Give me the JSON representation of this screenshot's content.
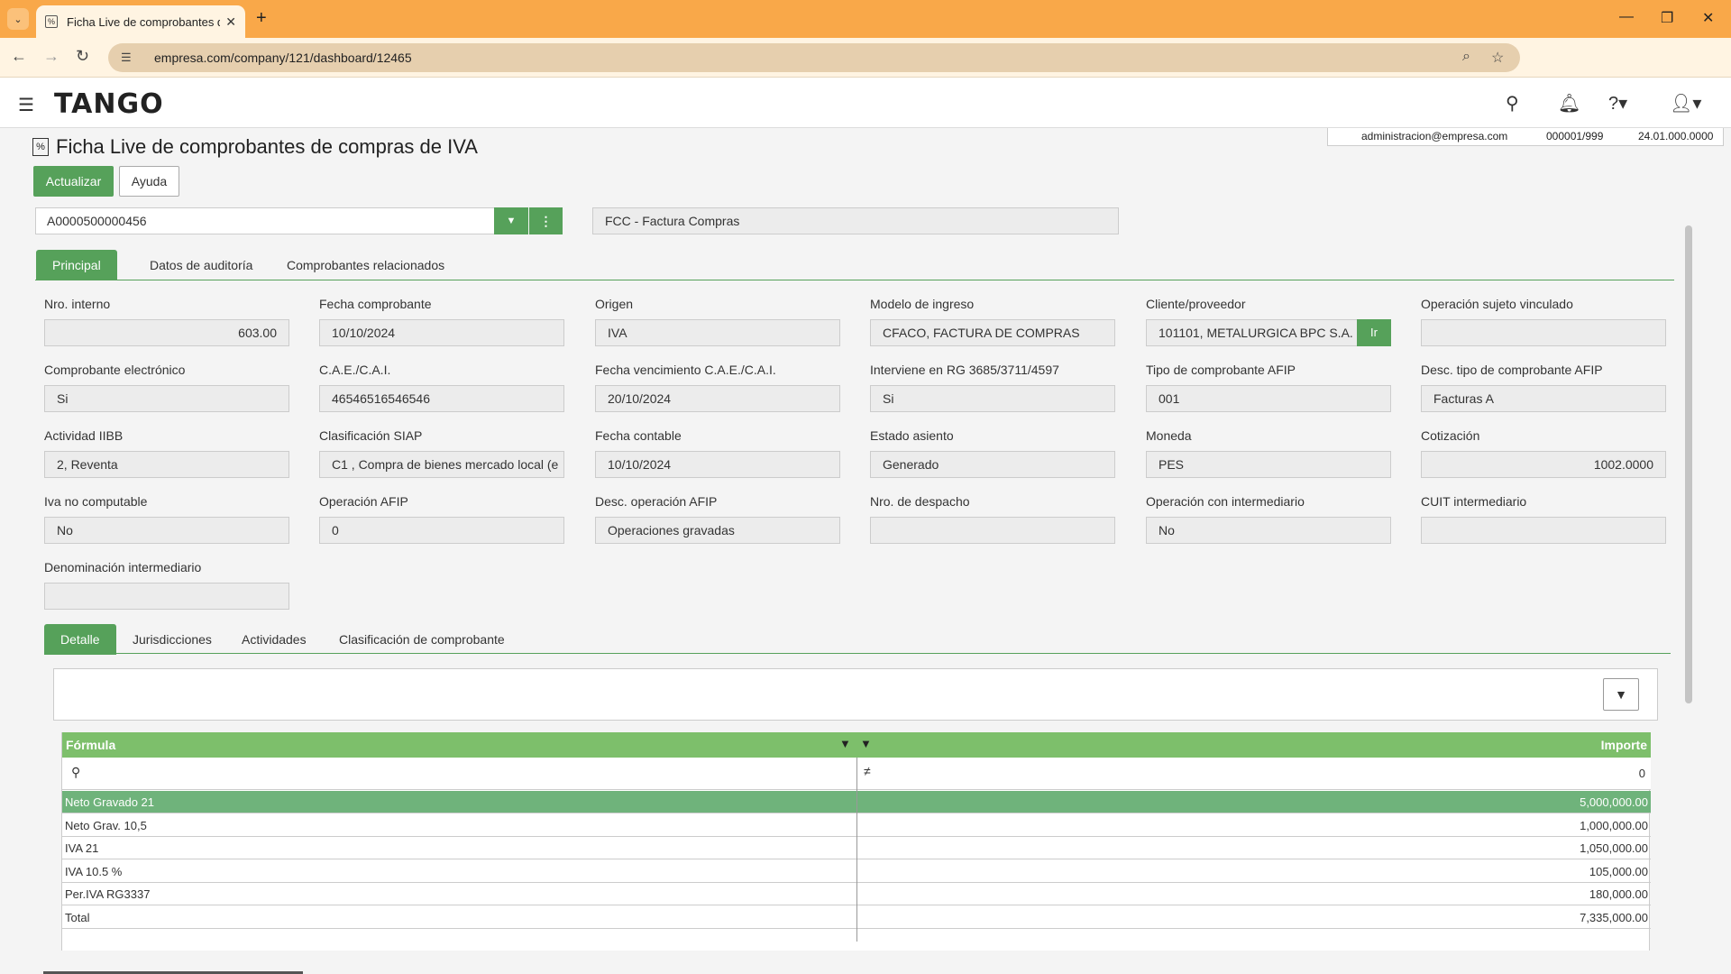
{
  "browser": {
    "tab_title": "Ficha Live de comprobantes de compras de IVA",
    "url": "empresa.com/company/121/dashboard/12465"
  },
  "header": {
    "logo": "TANGO"
  },
  "info": {
    "email": "administracion@empresa.com",
    "company": "000001/999",
    "version": "24.01.000.0000"
  },
  "page": {
    "title": "Ficha Live de comprobantes de compras de IVA",
    "btn_update": "Actualizar",
    "btn_help": "Ayuda",
    "selector_value": "A0000500000456",
    "selector_desc": "FCC - Factura Compras"
  },
  "tabs": [
    "Principal",
    "Datos de auditoría",
    "Comprobantes relacionados"
  ],
  "fields": [
    {
      "label": "Nro. interno",
      "value": "603.00",
      "align": "right"
    },
    {
      "label": "Fecha comprobante",
      "value": "10/10/2024"
    },
    {
      "label": "Origen",
      "value": "IVA"
    },
    {
      "label": "Modelo de ingreso",
      "value": "CFACO, FACTURA DE  COMPRAS"
    },
    {
      "label": "Cliente/proveedor",
      "value": "101101, METALURGICA BPC S.A.",
      "button": "Ir"
    },
    {
      "label": "Operación sujeto vinculado",
      "value": ""
    },
    {
      "label": "Comprobante electrónico",
      "value": "Si"
    },
    {
      "label": "C.A.E./C.A.I.",
      "value": "46546516546546"
    },
    {
      "label": "Fecha vencimiento C.A.E./C.A.I.",
      "value": "20/10/2024"
    },
    {
      "label": "Interviene en RG 3685/3711/4597",
      "value": "Si"
    },
    {
      "label": "Tipo de comprobante AFIP",
      "value": "001"
    },
    {
      "label": "Desc. tipo de comprobante AFIP",
      "value": "Facturas A"
    },
    {
      "label": "Actividad IIBB",
      "value": "2, Reventa"
    },
    {
      "label": "Clasificación SIAP",
      "value": "C1 , Compra de bienes mercado local (e"
    },
    {
      "label": "Fecha contable",
      "value": "10/10/2024"
    },
    {
      "label": "Estado asiento",
      "value": "Generado"
    },
    {
      "label": "Moneda",
      "value": "PES"
    },
    {
      "label": "Cotización",
      "value": "1002.0000",
      "align": "right"
    },
    {
      "label": "Iva no computable",
      "value": "No"
    },
    {
      "label": "Operación AFIP",
      "value": "0"
    },
    {
      "label": "Desc. operación AFIP",
      "value": "Operaciones gravadas"
    },
    {
      "label": "Nro. de despacho",
      "value": ""
    },
    {
      "label": "Operación con intermediario",
      "value": "No"
    },
    {
      "label": "CUIT intermediario",
      "value": ""
    },
    {
      "label": "Denominación intermediario",
      "value": ""
    }
  ],
  "subtabs": [
    "Detalle",
    "Jurisdicciones",
    "Actividades",
    "Clasificación de comprobante"
  ],
  "grid": {
    "col1": "Fórmula",
    "col2": "Importe",
    "filter_value": "0",
    "rows": [
      {
        "formula": "Neto Gravado 21",
        "importe": "5,000,000.00",
        "selected": true
      },
      {
        "formula": "Neto Grav. 10,5",
        "importe": "1,000,000.00"
      },
      {
        "formula": "IVA 21",
        "importe": "1,050,000.00"
      },
      {
        "formula": "IVA 10.5 %",
        "importe": "105,000.00"
      },
      {
        "formula": "Per.IVA RG3337",
        "importe": "180,000.00"
      },
      {
        "formula": "Total",
        "importe": "7,335,000.00"
      }
    ]
  },
  "colors": {
    "accent_green": "#56a15a",
    "browser_orange": "#f9a849"
  }
}
